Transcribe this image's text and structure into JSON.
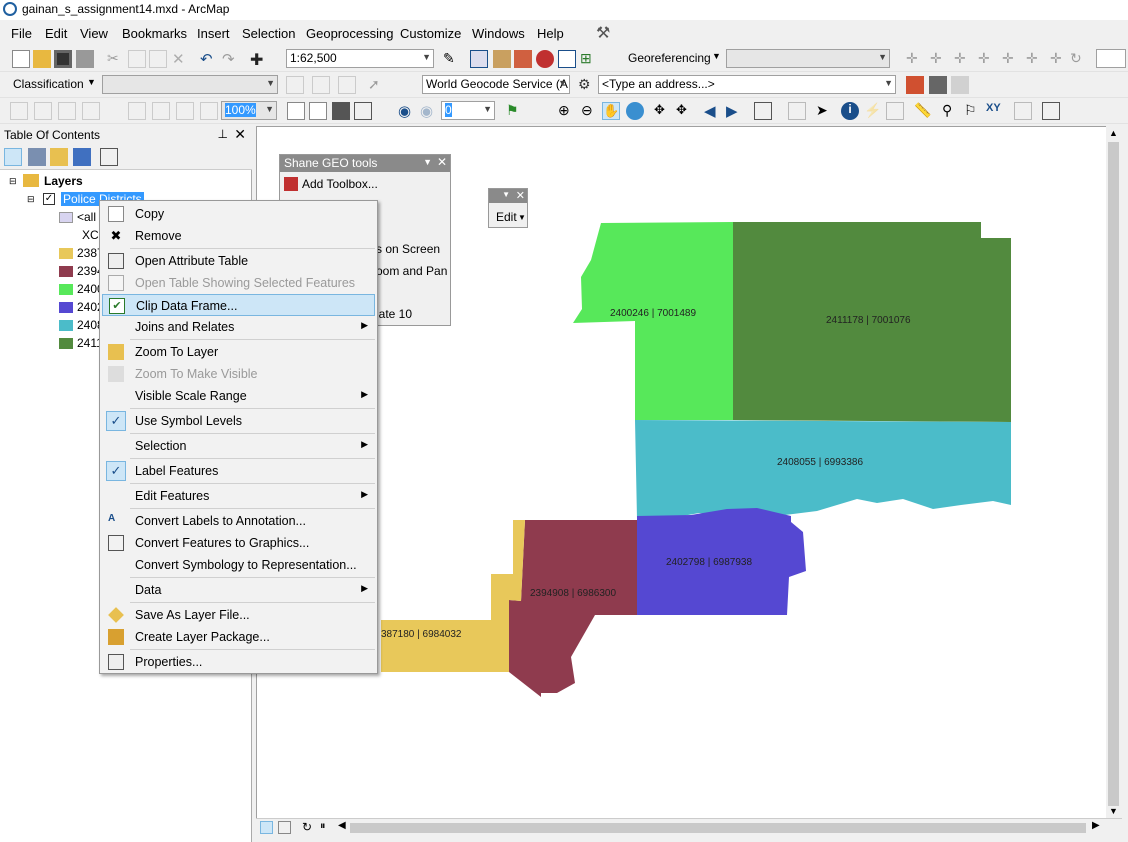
{
  "window": {
    "title": "gainan_s_assignment14.mxd - ArcMap"
  },
  "menubar": [
    "File",
    "Edit",
    "View",
    "Bookmarks",
    "Insert",
    "Selection",
    "Geoprocessing",
    "Customize",
    "Windows",
    "Help"
  ],
  "toolbar1": {
    "scale": "1:62,500",
    "georeferencing_label": "Georeferencing"
  },
  "toolbar2": {
    "classification_label": "Classification",
    "geocode_service": "World Geocode Service (A",
    "address_placeholder": "<Type an address...>"
  },
  "toolbar3": {
    "zoom": "100%",
    "number": "0"
  },
  "toc": {
    "title": "Table Of Contents",
    "layers_label": "Layers",
    "layer_name": "Police Districts",
    "all_label": "<all",
    "field_label": "XCo",
    "legend": [
      {
        "label": "2387",
        "color": "#e8c85a"
      },
      {
        "label": "2394",
        "color": "#8f3b4e"
      },
      {
        "label": "2400",
        "color": "#57e85a"
      },
      {
        "label": "2402",
        "color": "#5548d2"
      },
      {
        "label": "2408",
        "color": "#4bbcc9"
      },
      {
        "label": "2411",
        "color": "#528a3e"
      }
    ]
  },
  "geo_tools": {
    "title": "Shane GEO tools",
    "add_toolbox": "Add Toolbox...",
    "item_a": "...",
    "item_b": "s on Screen",
    "item_c": "oom and Pan",
    "item_d": "late 10"
  },
  "edit_toolbar": {
    "label": "Edit"
  },
  "context_menu": [
    {
      "label": "Copy"
    },
    {
      "label": "Remove"
    },
    {
      "label": "Open Attribute Table"
    },
    {
      "label": "Open Table Showing Selected Features"
    },
    {
      "label": "Clip Data Frame..."
    },
    {
      "label": "Joins and Relates"
    },
    {
      "label": "Zoom To Layer"
    },
    {
      "label": "Zoom To Make Visible"
    },
    {
      "label": "Visible Scale Range"
    },
    {
      "label": "Use Symbol Levels"
    },
    {
      "label": "Selection"
    },
    {
      "label": "Label Features"
    },
    {
      "label": "Edit Features"
    },
    {
      "label": "Convert Labels to Annotation..."
    },
    {
      "label": "Convert Features to Graphics..."
    },
    {
      "label": "Convert Symbology to Representation..."
    },
    {
      "label": "Data"
    },
    {
      "label": "Save As Layer File..."
    },
    {
      "label": "Create Layer Package..."
    },
    {
      "label": "Properties..."
    }
  ],
  "map_labels": {
    "d2400": "2400246 | 7001489",
    "d2411": "2411178 | 7001076",
    "d2408": "2408055 | 6993386",
    "d2402": "2402798 | 6987938",
    "d2394": "2394908 | 6986300",
    "d2387": "387180 | 6984032"
  }
}
